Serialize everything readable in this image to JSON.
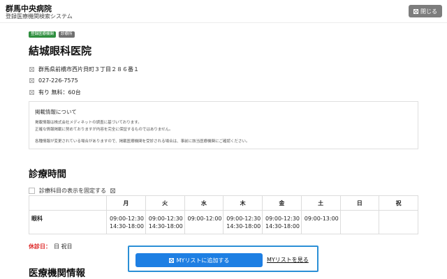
{
  "header": {
    "site_name": "群馬中央病院",
    "site_subtitle": "登録医療機関検索システム",
    "close_label": "閉じる",
    "close_icon": "close-icon"
  },
  "tags": [
    "登録医療機関",
    "診療所"
  ],
  "clinic": {
    "name": "結城眼科医院",
    "address": "群馬県前橋市西片貝町３丁目２８６番１",
    "phone": "027-226-7575",
    "parking": "有り 無料：60台"
  },
  "notice": {
    "title": "掲載情報について",
    "lines": [
      "掲載情報は株式会社メディネットの調査に基づいております。",
      "正確な情報掲載に努めておりますが内容を完全に保証するものではありません。",
      "各種情報が変更されている場合がありますので、掲載医療機関を受診される場合は、事前に該当医療機関にご確認ください。"
    ]
  },
  "schedule_section": {
    "title": "診療時間",
    "fix_label": "診療科目の表示を固定する"
  },
  "schedule": {
    "days": [
      "月",
      "火",
      "水",
      "木",
      "金",
      "土",
      "日",
      "祝"
    ],
    "rows": [
      {
        "label": "眼科",
        "cells": [
          [
            "09:00-12:30",
            "14:30-18:00"
          ],
          [
            "09:00-12:30",
            "14:30-18:00"
          ],
          [
            "09:00-12:00",
            ""
          ],
          [
            "09:00-12:30",
            "14:30-18:00"
          ],
          [
            "09:00-12:30",
            "14:30-18:00"
          ],
          [
            "09:00-13:00",
            ""
          ],
          [
            "",
            ""
          ],
          [
            "",
            ""
          ]
        ]
      }
    ]
  },
  "holiday": {
    "label": "休診日：",
    "value": "日 祝日"
  },
  "mylist": {
    "add_label": "MYリストに追加する",
    "view_label": "MYリストを見る"
  },
  "facility_section": {
    "title": "医療機関情報"
  },
  "colors": {
    "primary_blue": "#1e7fe3",
    "tag_green": "#2f8f3f",
    "holiday_red": "#dd2222"
  }
}
